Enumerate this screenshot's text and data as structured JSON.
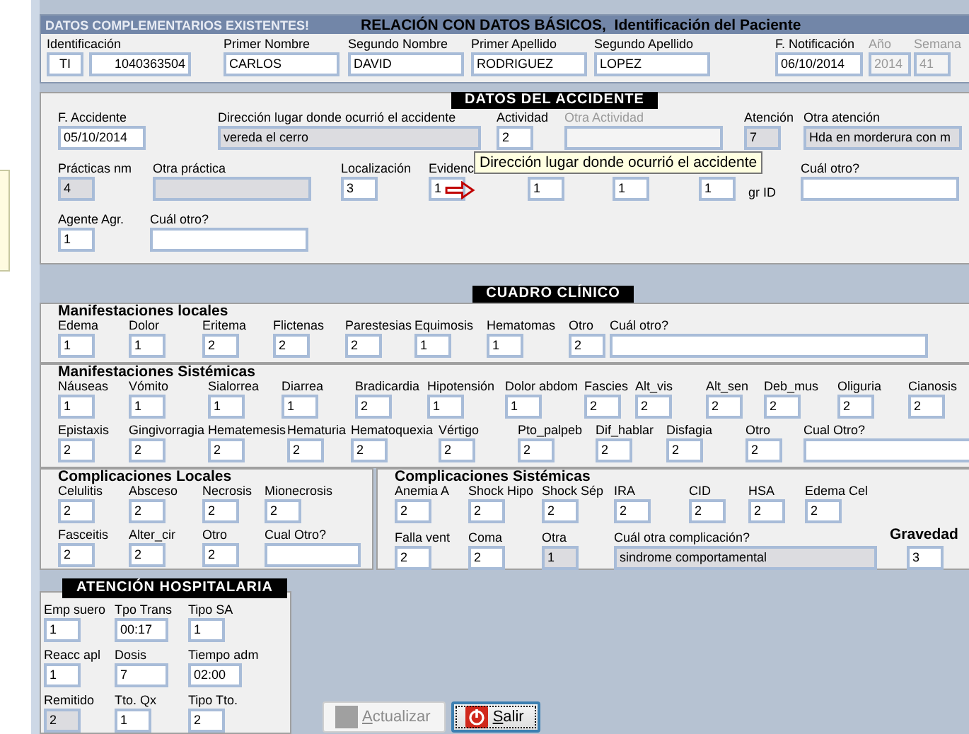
{
  "window": {
    "banner": "DATOS COMPLEMENTARIOS EXISTENTES!",
    "title": "RELACIÓN CON DATOS BÁSICOS,  Identificación del Paciente"
  },
  "patient": {
    "rows": [
      {
        "fields": [
          {
            "label": "Identificación",
            "value": "TI",
            "kind": "type",
            "readonly": false,
            "disabled": false
          },
          {
            "value": "1040363504",
            "kind": "id",
            "readonly": false,
            "disabled": false
          },
          {
            "label": "Primer Nombre",
            "value": "CARLOS",
            "kind": "name",
            "readonly": false,
            "disabled": false
          },
          {
            "label": "Segundo Nombre",
            "value": "DAVID",
            "kind": "name",
            "readonly": false,
            "disabled": false
          },
          {
            "label": "Primer Apellido",
            "value": "RODRIGUEZ",
            "kind": "name",
            "readonly": false,
            "disabled": false
          },
          {
            "label": "Segundo Apellido",
            "value": "LOPEZ",
            "kind": "name",
            "readonly": false,
            "disabled": false
          },
          {
            "label": "F. Notificación",
            "value": "06/10/2014",
            "kind": "date",
            "readonly": false,
            "disabled": false
          },
          {
            "label": "Año",
            "value": "2014",
            "kind": "year",
            "readonly": false,
            "disabled": true
          },
          {
            "label": "Semana",
            "value": "41",
            "kind": "code",
            "readonly": false,
            "disabled": true
          }
        ]
      }
    ]
  },
  "accident": {
    "title": "DATOS DEL ACCIDENTE",
    "tooltip": "Dirección lugar donde ocurrió el accidente",
    "rows": [
      {
        "fields": [
          {
            "label": "F. Accidente",
            "value": "05/10/2014",
            "kind": "date",
            "readonly": false,
            "disabled": false
          },
          {
            "label": "Dirección lugar donde ocurrió el accidente",
            "value": "vereda el cerro",
            "kind": "long",
            "readonly": true,
            "disabled": false
          },
          {
            "label": "Actividad",
            "value": "2",
            "kind": "code",
            "readonly": false,
            "disabled": false
          },
          {
            "label": "Otra Actividad",
            "kind": "text",
            "readonly": false,
            "disabled": true
          },
          {
            "label": "Atención",
            "value": "7",
            "kind": "code",
            "readonly": true,
            "disabled": false
          },
          {
            "label": "Otra atención",
            "value": "Hda en morderura con m",
            "kind": "text",
            "readonly": true,
            "disabled": false
          }
        ]
      },
      {
        "fields": [
          {
            "label": "Prácticas nm",
            "value": "4",
            "kind": "code",
            "readonly": true,
            "disabled": false
          },
          {
            "label": "Otra práctica",
            "kind": "text",
            "readonly": true,
            "disabled": false
          },
          {
            "label": "Localización",
            "value": "3",
            "kind": "code",
            "readonly": false,
            "disabled": false
          },
          {
            "label": "Evidenc",
            "value": "1",
            "kind": "code",
            "readonly": false,
            "disabled": false
          },
          {
            "value": "1",
            "kind": "code",
            "readonly": false,
            "disabled": false
          },
          {
            "value": "1",
            "kind": "code",
            "readonly": false,
            "disabled": false
          },
          {
            "value": "1",
            "kind": "code",
            "readonly": false,
            "disabled": false
          },
          {
            "label": "gr ID",
            "kind": "label",
            "disabled": false
          },
          {
            "label": "Cuál otro?",
            "kind": "text",
            "readonly": false,
            "disabled": false
          }
        ]
      },
      {
        "fields": [
          {
            "label": "Agente Agr.",
            "value": "1",
            "kind": "code",
            "readonly": false,
            "disabled": false
          },
          {
            "label": "Cuál otro?",
            "kind": "text",
            "readonly": false,
            "disabled": false
          }
        ]
      }
    ]
  },
  "clinical": {
    "title": "CUADRO CLÍNICO",
    "sections": [
      {
        "title": "Manifestaciones locales",
        "rows": [
          {
            "fields": [
              {
                "label": "Edema",
                "value": "1",
                "kind": "code",
                "readonly": false,
                "disabled": false
              },
              {
                "label": "Dolor",
                "value": "1",
                "kind": "code",
                "readonly": false,
                "disabled": false
              },
              {
                "label": "Eritema",
                "value": "2",
                "kind": "code",
                "readonly": false,
                "disabled": false
              },
              {
                "label": "Flictenas",
                "value": "2",
                "kind": "code",
                "readonly": false,
                "disabled": false
              },
              {
                "label": "Parestesias",
                "value": "2",
                "kind": "code",
                "readonly": false,
                "disabled": false
              },
              {
                "label": "Equimosis",
                "value": "1",
                "kind": "code",
                "readonly": false,
                "disabled": false
              },
              {
                "label": "Hematomas",
                "value": "1",
                "kind": "code",
                "readonly": false,
                "disabled": false
              },
              {
                "label": "Otro",
                "value": "2",
                "kind": "code",
                "readonly": false,
                "disabled": false
              },
              {
                "label": "Cuál otro?",
                "kind": "wide",
                "readonly": false,
                "disabled": false
              }
            ]
          }
        ]
      },
      {
        "title": "Manifestaciones Sistémicas",
        "rows": [
          {
            "fields": [
              {
                "label": "Náuseas",
                "value": "1",
                "kind": "code",
                "readonly": false,
                "disabled": false
              },
              {
                "label": "Vómito",
                "value": "1",
                "kind": "code",
                "readonly": false,
                "disabled": false
              },
              {
                "label": "Sialorrea",
                "value": "1",
                "kind": "code",
                "readonly": false,
                "disabled": false
              },
              {
                "label": "Diarrea",
                "value": "1",
                "kind": "code",
                "readonly": false,
                "disabled": false
              },
              {
                "label": "Bradicardia",
                "value": "2",
                "kind": "code",
                "readonly": false,
                "disabled": false
              },
              {
                "label": "Hipotensión",
                "value": "1",
                "kind": "code",
                "readonly": false,
                "disabled": false
              },
              {
                "label": "Dolor abdom",
                "value": "1",
                "kind": "code",
                "readonly": false,
                "disabled": false
              },
              {
                "label": "Fascies",
                "value": "2",
                "kind": "code",
                "readonly": false,
                "disabled": false
              },
              {
                "label": "Alt_vis",
                "value": "2",
                "kind": "code",
                "readonly": false,
                "disabled": false
              },
              {
                "label": "Alt_sen",
                "value": "2",
                "kind": "code",
                "readonly": false,
                "disabled": false
              },
              {
                "label": "Deb_mus",
                "value": "2",
                "kind": "code",
                "readonly": false,
                "disabled": false
              },
              {
                "label": "Oliguria",
                "value": "2",
                "kind": "code",
                "readonly": false,
                "disabled": false
              },
              {
                "label": "Cianosis",
                "value": "2",
                "kind": "code",
                "readonly": false,
                "disabled": false
              }
            ]
          },
          {
            "fields": [
              {
                "label": "Epistaxis",
                "value": "2",
                "kind": "code",
                "readonly": false,
                "disabled": false
              },
              {
                "label": "Gingivorragia",
                "value": "2",
                "kind": "code",
                "readonly": false,
                "disabled": false
              },
              {
                "label": "Hematemesis",
                "value": "2",
                "kind": "code",
                "readonly": false,
                "disabled": false
              },
              {
                "label": "Hematuria",
                "value": "2",
                "kind": "code",
                "readonly": false,
                "disabled": false
              },
              {
                "label": "Hematoquexia",
                "value": "2",
                "kind": "code",
                "readonly": false,
                "disabled": false
              },
              {
                "label": "Vértigo",
                "value": "2",
                "kind": "code",
                "readonly": false,
                "disabled": false
              },
              {
                "label": "Pto_palpeb",
                "value": "2",
                "kind": "code",
                "readonly": false,
                "disabled": false
              },
              {
                "label": "Dif_hablar",
                "value": "2",
                "kind": "code",
                "readonly": false,
                "disabled": false
              },
              {
                "label": "Disfagia",
                "value": "2",
                "kind": "code",
                "readonly": false,
                "disabled": false
              },
              {
                "label": "Otro",
                "value": "2",
                "kind": "code",
                "readonly": false,
                "disabled": false
              },
              {
                "label": "Cual Otro?",
                "kind": "wide",
                "readonly": false,
                "disabled": false
              }
            ]
          }
        ]
      },
      {
        "title": "Complicaciones Locales",
        "rows": [
          {
            "fields": [
              {
                "label": "Celulitis",
                "value": "2",
                "kind": "code",
                "readonly": false,
                "disabled": false
              },
              {
                "label": "Absceso",
                "value": "2",
                "kind": "code",
                "readonly": false,
                "disabled": false
              },
              {
                "label": "Necrosis",
                "value": "2",
                "kind": "code",
                "readonly": false,
                "disabled": false
              },
              {
                "label": "Mionecrosis",
                "value": "2",
                "kind": "code",
                "readonly": false,
                "disabled": false
              }
            ]
          },
          {
            "fields": [
              {
                "label": "Fasceitis",
                "value": "2",
                "kind": "code",
                "readonly": false,
                "disabled": false
              },
              {
                "label": "Alter_cir",
                "value": "2",
                "kind": "code",
                "readonly": false,
                "disabled": false
              },
              {
                "label": "Otro",
                "value": "2",
                "kind": "code",
                "readonly": false,
                "disabled": false
              },
              {
                "label": "Cual Otro?",
                "kind": "short",
                "readonly": false,
                "disabled": false
              }
            ]
          }
        ]
      },
      {
        "title": "Complicaciones Sistémicas",
        "rows": [
          {
            "fields": [
              {
                "label": "Anemia A",
                "value": "2",
                "kind": "code",
                "readonly": false,
                "disabled": false
              },
              {
                "label": "Shock Hipo",
                "value": "2",
                "kind": "code",
                "readonly": false,
                "disabled": false
              },
              {
                "label": "Shock Sép",
                "value": "2",
                "kind": "code",
                "readonly": false,
                "disabled": false
              },
              {
                "label": "IRA",
                "value": "2",
                "kind": "code",
                "readonly": false,
                "disabled": false
              },
              {
                "label": "CID",
                "value": "2",
                "kind": "code",
                "readonly": false,
                "disabled": false
              },
              {
                "label": "HSA",
                "value": "2",
                "kind": "code",
                "readonly": false,
                "disabled": false
              },
              {
                "label": "Edema Cel",
                "value": "2",
                "kind": "code",
                "readonly": false,
                "disabled": false
              }
            ]
          },
          {
            "fields": [
              {
                "label": "Falla vent",
                "value": "2",
                "kind": "code",
                "readonly": false,
                "disabled": false
              },
              {
                "label": "Coma",
                "value": "2",
                "kind": "code",
                "readonly": false,
                "disabled": false
              },
              {
                "label": "Otra",
                "value": "1",
                "kind": "code",
                "readonly": true,
                "disabled": false
              },
              {
                "label": "Cuál otra complicación?",
                "value": "sindrome comportamental",
                "kind": "long",
                "readonly": true,
                "disabled": false
              },
              {
                "label": "Gravedad",
                "value": "3",
                "kind": "score",
                "readonly": false,
                "disabled": false
              }
            ]
          }
        ]
      }
    ]
  },
  "hospital": {
    "title": "ATENCIÓN HOSPITALARIA",
    "rows": [
      {
        "fields": [
          {
            "label": "Emp suero",
            "value": "1",
            "kind": "code",
            "readonly": false,
            "disabled": false
          },
          {
            "label": "Tpo Trans",
            "value": "00:17",
            "kind": "time",
            "readonly": false,
            "disabled": false
          },
          {
            "label": "Tipo SA",
            "value": "1",
            "kind": "code",
            "readonly": false,
            "disabled": false
          }
        ]
      },
      {
        "fields": [
          {
            "label": "Reacc apl",
            "value": "1",
            "kind": "code",
            "readonly": false,
            "disabled": false
          },
          {
            "label": "Dosis",
            "value": "7",
            "kind": "time",
            "readonly": false,
            "disabled": false
          },
          {
            "label": "Tiempo adm",
            "value": "02:00",
            "kind": "time",
            "readonly": false,
            "disabled": false
          }
        ]
      },
      {
        "fields": [
          {
            "label": "Remitido",
            "value": "2",
            "kind": "code",
            "readonly": true,
            "disabled": false
          },
          {
            "label": "Tto. Qx",
            "value": "1",
            "kind": "code",
            "readonly": false,
            "disabled": false
          },
          {
            "label": "Tipo Tto.",
            "value": "2",
            "kind": "code",
            "readonly": false,
            "disabled": false
          }
        ]
      }
    ]
  },
  "buttons": [
    {
      "label": "Actualizar",
      "kind": "update",
      "disabled": true,
      "focused": false
    },
    {
      "label": "Salir",
      "kind": "exit",
      "disabled": false,
      "focused": true
    }
  ]
}
